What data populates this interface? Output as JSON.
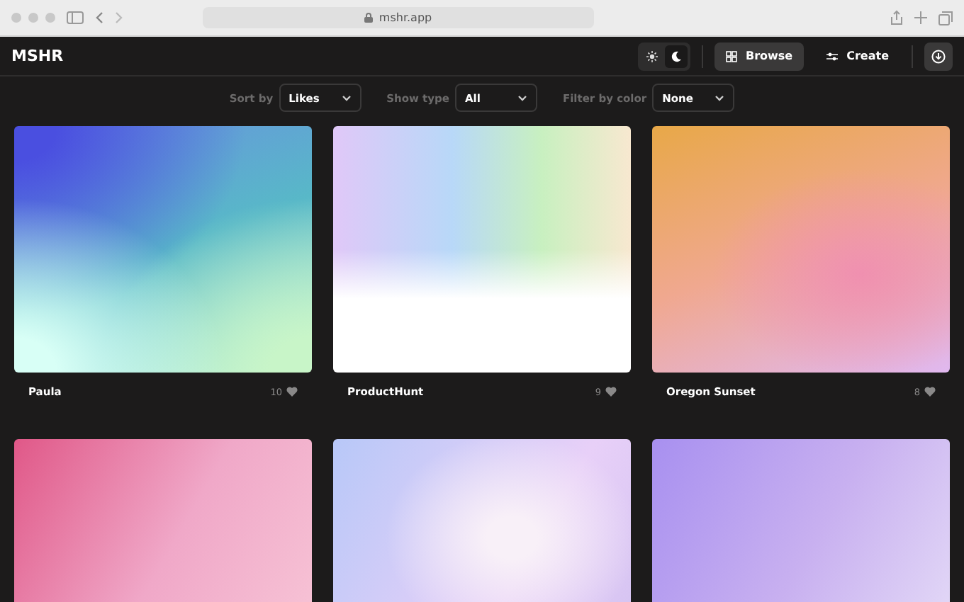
{
  "browser": {
    "url": "mshr.app"
  },
  "header": {
    "logo": "MSHR",
    "theme": [
      {
        "kind": "light",
        "selected": false
      },
      {
        "kind": "dark",
        "selected": true
      }
    ],
    "nav": [
      {
        "label": "Browse",
        "kind": "grid",
        "selected": true
      },
      {
        "label": "Create",
        "kind": "sliders",
        "selected": false
      }
    ]
  },
  "filters": [
    {
      "label": "Sort by",
      "value": "Likes"
    },
    {
      "label": "Show type",
      "value": "All"
    },
    {
      "label": "Filter by color",
      "value": "None"
    }
  ],
  "cards": [
    {
      "kind": "full",
      "name": "Paula",
      "likes": "10"
    },
    {
      "kind": "full",
      "name": "ProductHunt",
      "likes": "9"
    },
    {
      "kind": "full",
      "name": "Oregon Sunset",
      "likes": "8"
    },
    {
      "kind": "cropped"
    },
    {
      "kind": "cropped"
    },
    {
      "kind": "cropped"
    }
  ]
}
